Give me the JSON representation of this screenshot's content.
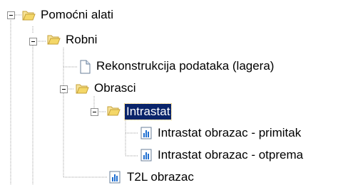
{
  "tree": {
    "nodes": [
      {
        "label": "Pomoćni alati",
        "icon": "folder-open-icon",
        "expanded": true
      },
      {
        "label": "Robni",
        "icon": "folder-open-icon",
        "expanded": true
      },
      {
        "label": "Rekonstrukcija podataka (lagera)",
        "icon": "document-icon"
      },
      {
        "label": "Obrasci",
        "icon": "folder-open-icon",
        "expanded": true
      },
      {
        "label": "Intrastat",
        "icon": "folder-open-icon",
        "expanded": true,
        "selected": true
      },
      {
        "label": "Intrastat obrazac - primitak",
        "icon": "report-icon"
      },
      {
        "label": "Intrastat obrazac - otprema",
        "icon": "report-icon"
      },
      {
        "label": "T2L obrazac",
        "icon": "report-icon"
      }
    ]
  },
  "colors": {
    "selection": "#0a246a",
    "tree_line": "#a0a0a0",
    "folder": "#f4d768"
  }
}
